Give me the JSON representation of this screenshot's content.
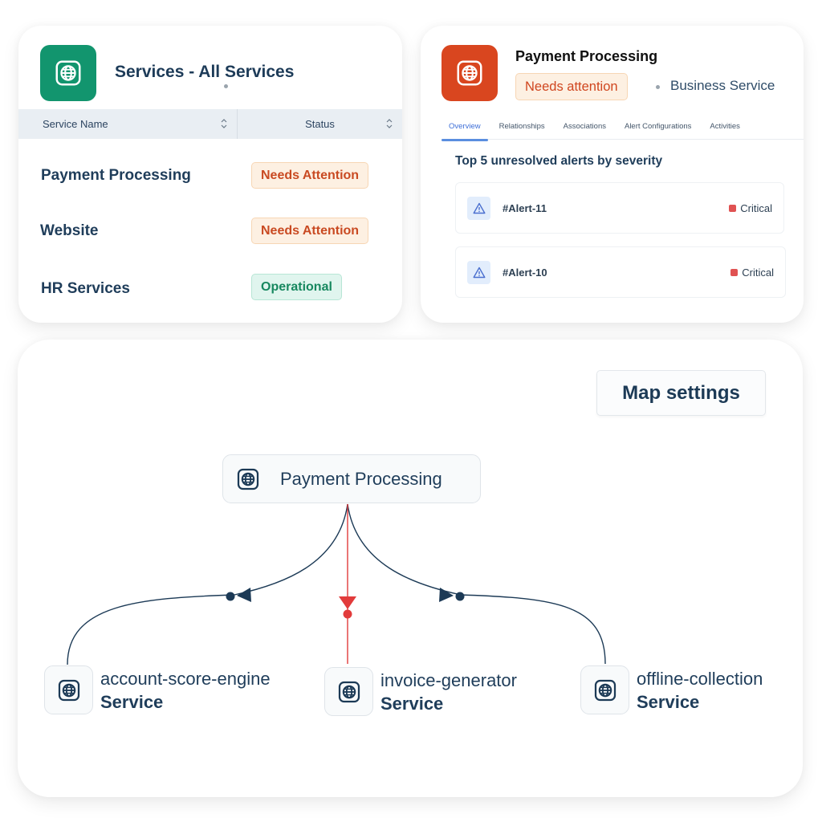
{
  "services_card": {
    "title": "Services - All Services",
    "icon": "globe-icon",
    "accent_color": "#12956e",
    "columns": [
      {
        "label": "Service Name",
        "sortable": true
      },
      {
        "label": "Status",
        "sortable": true
      }
    ],
    "rows": [
      {
        "name": "Payment Processing",
        "status": "Needs Attention",
        "status_kind": "warn"
      },
      {
        "name": "Website",
        "status": "Needs Attention",
        "status_kind": "warn"
      },
      {
        "name": "HR Services",
        "status": "Operational",
        "status_kind": "ok"
      }
    ]
  },
  "detail_card": {
    "title": "Payment Processing",
    "icon": "globe-icon",
    "accent_color": "#d9461f",
    "status_badge": "Needs attention",
    "service_type": "Business Service",
    "tabs": [
      {
        "label": "Overview",
        "active": true
      },
      {
        "label": "Relationships",
        "active": false
      },
      {
        "label": "Associations",
        "active": false
      },
      {
        "label": "Alert Configurations",
        "active": false
      },
      {
        "label": "Activities",
        "active": false
      }
    ],
    "alerts_heading": "Top 5 unresolved alerts by severity",
    "alerts": [
      {
        "id": "#Alert-11",
        "severity": "Critical",
        "icon": "warning-icon"
      },
      {
        "id": "#Alert-10",
        "severity": "Critical",
        "icon": "warning-icon"
      }
    ],
    "severity_color": "#e05252"
  },
  "map_card": {
    "settings_button": "Map settings",
    "root_node": {
      "name": "Payment Processing",
      "icon": "globe-icon"
    },
    "child_nodes": [
      {
        "name": "account-score-engine",
        "type": "Service",
        "icon": "globe-icon",
        "edge_color": "#1c3a56"
      },
      {
        "name": "invoice-generator",
        "type": "Service",
        "icon": "globe-icon",
        "edge_color": "#e23b3b"
      },
      {
        "name": "offline-collection",
        "type": "Service",
        "icon": "globe-icon",
        "edge_color": "#1c3a56"
      }
    ]
  }
}
